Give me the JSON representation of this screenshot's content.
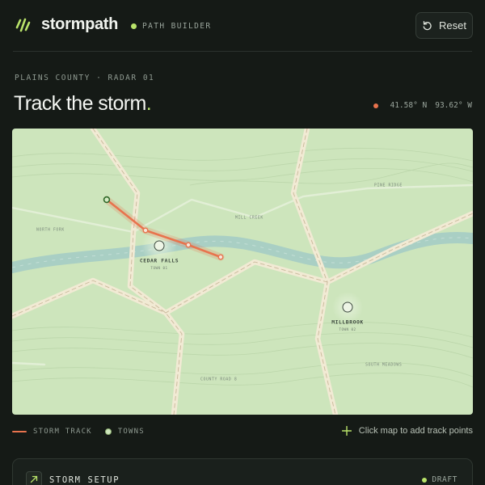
{
  "header": {
    "brand": "stormpath",
    "mode_label": "PATH BUILDER",
    "reset_label": "Reset"
  },
  "title_area": {
    "breadcrumb": "PLAINS COUNTY · RADAR 01",
    "title": "Track the storm",
    "title_accent": ".",
    "latitude": "41.58° N",
    "longitude": "93.62° W"
  },
  "map": {
    "towns": [
      {
        "name": "CEDAR FALLS",
        "sub": "TOWN 01"
      },
      {
        "name": "MILLBROOK",
        "sub": "TOWN 02"
      }
    ],
    "places": [
      "NORTH FORK",
      "MILL CREEK",
      "PINE RIDGE",
      "SOUTH MEADOWS",
      "COUNTY ROAD 8"
    ],
    "track_point_count": 4
  },
  "legend": {
    "storm_track": "STORM TRACK",
    "towns": "TOWNS",
    "hint": "Click map to add track points"
  },
  "panel": {
    "title": "STORM SETUP",
    "status": "DRAFT"
  },
  "colors": {
    "accent": "#b9e36a",
    "track": "#e8734d",
    "map_bg": "#cde5bc",
    "river": "#a9cfc4"
  }
}
